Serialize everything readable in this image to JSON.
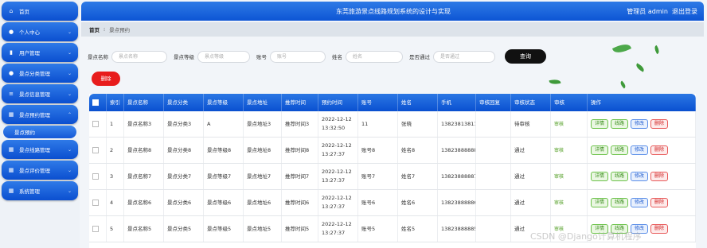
{
  "app": {
    "title": "东莞旅游景点线路规划系统的设计与实现",
    "user": "管理员 admin",
    "logout": "退出登录"
  },
  "sidebar": {
    "items": [
      {
        "label": "首页",
        "icon": "home-icon",
        "glyph": "⌂",
        "chev": ""
      },
      {
        "label": "个人中心",
        "icon": "user-icon",
        "glyph": "●",
        "chev": "⌄"
      },
      {
        "label": "用户管理",
        "icon": "chart-icon",
        "glyph": "▮",
        "chev": "⌄"
      },
      {
        "label": "景点分类管理",
        "icon": "user-icon",
        "glyph": "●",
        "chev": "⌄"
      },
      {
        "label": "景点信息管理",
        "icon": "list-icon",
        "glyph": "≡",
        "chev": "⌄"
      },
      {
        "label": "景点预约管理",
        "icon": "grid-icon",
        "glyph": "▦",
        "chev": "⌃"
      },
      {
        "label": "景点线路管理",
        "icon": "grid-icon",
        "glyph": "▦",
        "chev": "⌄"
      },
      {
        "label": "景点评价管理",
        "icon": "grid-icon",
        "glyph": "▦",
        "chev": "⌄"
      },
      {
        "label": "系统管理",
        "icon": "grid-icon",
        "glyph": "▦",
        "chev": "⌄"
      }
    ],
    "active_sub": "景点预约"
  },
  "breadcrumb": {
    "home": "首页",
    "sep": "⁝",
    "current": "景点预约"
  },
  "search": {
    "fields": [
      {
        "label": "景点名称",
        "placeholder": "景点名称"
      },
      {
        "label": "景点等级",
        "placeholder": "景点等级"
      },
      {
        "label": "账号",
        "placeholder": "账号"
      },
      {
        "label": "姓名",
        "placeholder": "姓名"
      },
      {
        "label": "是否通过",
        "placeholder": "是否通过"
      }
    ],
    "button": "查询"
  },
  "delete_button": "删除",
  "table": {
    "headers": [
      "",
      "索引",
      "景点名称",
      "景点分类",
      "景点等级",
      "景点地址",
      "推荐时间",
      "预约时间",
      "账号",
      "姓名",
      "手机",
      "审核回复",
      "审核状态",
      "审核",
      "操作"
    ],
    "rows": [
      [
        "1",
        "景点名称3",
        "景点分类3",
        "A",
        "景点地址3",
        "推荐时间3",
        "2022-12-12 13:32:50",
        "11",
        "张晓",
        "13823813811",
        "",
        "待审核",
        "审核"
      ],
      [
        "2",
        "景点名称8",
        "景点分类8",
        "景点等级8",
        "景点地址8",
        "推荐时间8",
        "2022-12-12 13:27:37",
        "账号8",
        "姓名8",
        "13823888888",
        "",
        "通过",
        "审核"
      ],
      [
        "3",
        "景点名称7",
        "景点分类7",
        "景点等级7",
        "景点地址7",
        "推荐时间7",
        "2022-12-12 13:27:37",
        "账号7",
        "姓名7",
        "13823888887",
        "",
        "通过",
        "审核"
      ],
      [
        "4",
        "景点名称6",
        "景点分类6",
        "景点等级6",
        "景点地址6",
        "推荐时间6",
        "2022-12-12 13:27:37",
        "账号6",
        "姓名6",
        "13823888886",
        "",
        "通过",
        "审核"
      ],
      [
        "5",
        "景点名称5",
        "景点分类5",
        "景点等级5",
        "景点地址5",
        "推荐时间5",
        "2022-12-12 13:27:37",
        "账号5",
        "姓名5",
        "13823888885",
        "",
        "通过",
        "审核"
      ]
    ],
    "actions": [
      "详情",
      "线路",
      "修改",
      "删除"
    ]
  },
  "watermark": "CSDN @Django计算机程序"
}
